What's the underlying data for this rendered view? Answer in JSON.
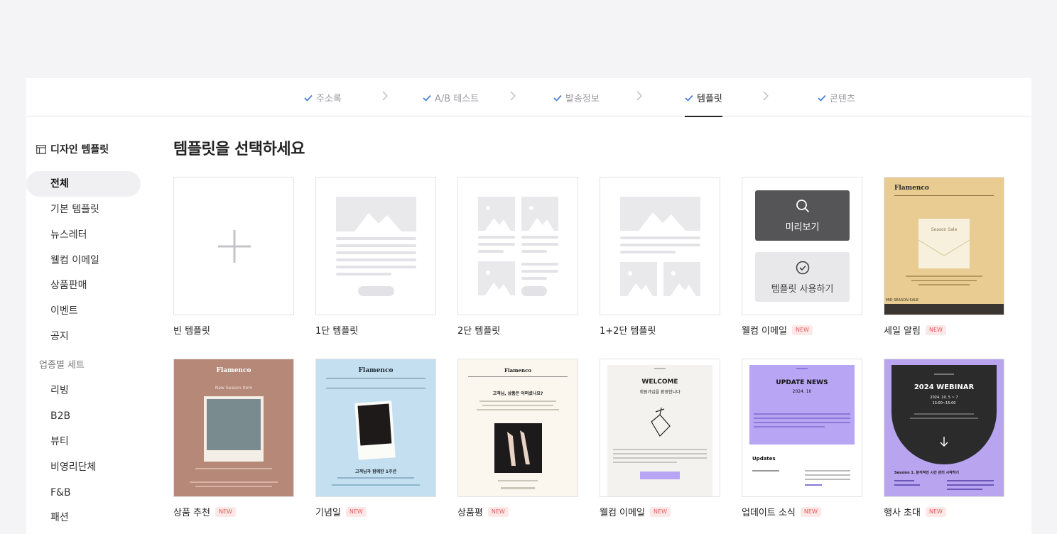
{
  "stepper": {
    "steps": [
      {
        "label": "주소록",
        "state": "done"
      },
      {
        "label": "A/B 테스트",
        "state": "done"
      },
      {
        "label": "발송정보",
        "state": "done"
      },
      {
        "label": "템플릿",
        "state": "active"
      },
      {
        "label": "콘텐츠",
        "state": "done"
      }
    ]
  },
  "sidebar": {
    "title": "디자인 템플릿",
    "items": [
      "전체",
      "기본 템플릿",
      "뉴스레터",
      "웰컴 이메일",
      "상품판매",
      "이벤트",
      "공지"
    ],
    "group_label": "업종별 세트",
    "group_items": [
      "리빙",
      "B2B",
      "뷰티",
      "비영리단체",
      "F&B",
      "패션"
    ]
  },
  "main": {
    "title": "템플릿을 선택하세요",
    "new_badge": "NEW",
    "hover": {
      "preview": "미리보기",
      "use": "템플릿 사용하기"
    },
    "cards": [
      {
        "label": "빈 템플릿",
        "new": false
      },
      {
        "label": "1단 템플릿",
        "new": false
      },
      {
        "label": "2단 템플릿",
        "new": false
      },
      {
        "label": "1+2단 템플릿",
        "new": false
      },
      {
        "label": "웰컴 이메일",
        "new": true
      },
      {
        "label": "세일 알림",
        "new": true
      },
      {
        "label": "상품 추천",
        "new": true
      },
      {
        "label": "기념일",
        "new": true
      },
      {
        "label": "상품평",
        "new": true
      },
      {
        "label": "웰컴 이메일",
        "new": true
      },
      {
        "label": "업데이트 소식",
        "new": true
      },
      {
        "label": "행사 초대",
        "new": true
      }
    ],
    "thumbs": {
      "sale": {
        "brand": "Flamenco",
        "headline": "Season Sale",
        "footer": "MID SEASON SALE"
      },
      "recommend": {
        "brand": "Flamenco",
        "headline": "New Season Item"
      },
      "anniversary": {
        "brand": "Flamenco",
        "headline": "고객님과 함께한 1주년"
      },
      "review": {
        "brand": "Flamenco",
        "headline": "고객님, 상품은 어떠셨나요?"
      },
      "welcome": {
        "headline": "WELCOME",
        "sub": "회원가입을 환영합니다"
      },
      "update": {
        "headline": "UPDATE NEWS",
        "date": "2024. 10",
        "section": "Updates"
      },
      "webinar": {
        "headline": "2024 WEBINAR",
        "date": "2024. 10. 5 ~ 7",
        "time": "13:00~15:00",
        "session": "Session 1. 분석적인 시간 관리 시작하기"
      }
    }
  },
  "colors": {
    "check": "#4a7fd6",
    "sale_bg": "#e8cc92",
    "recommend_bg": "#b58878",
    "anniversary_bg": "#c4dff0",
    "review_bg": "#fbf7ee",
    "welcome_bg": "#f3f2ee",
    "update_bg": "#b8a6f5",
    "webinar_bg": "#b9a4f0"
  }
}
